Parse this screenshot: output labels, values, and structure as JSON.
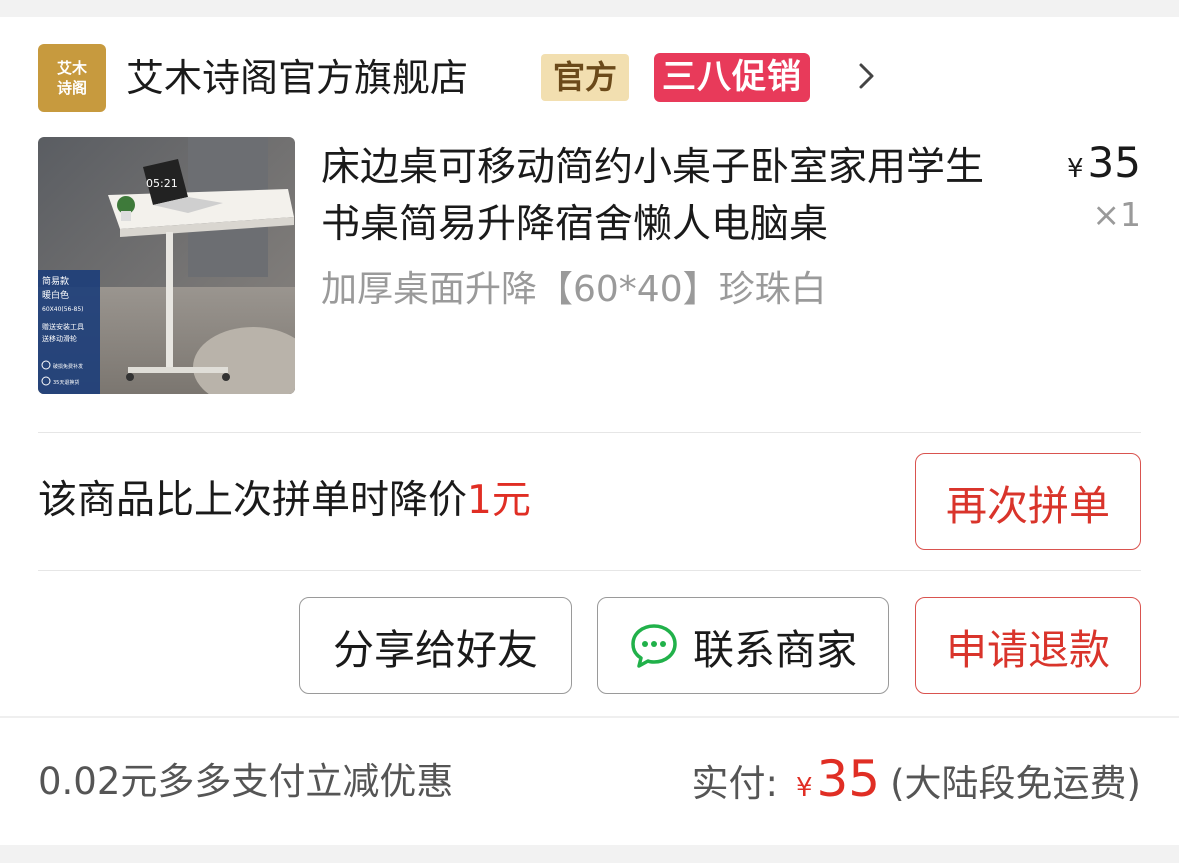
{
  "store": {
    "logo_line1": "艾木",
    "logo_line2": "诗阁",
    "name": "艾木诗阁官方旗舰店",
    "badge_official": "官方",
    "badge_promo": "三八促销",
    "chevron_icon": "chevron-right-icon"
  },
  "product": {
    "title": "床边桌可移动简约小桌子卧室家用学生书桌简易升降宿舍懒人电脑桌",
    "spec": "加厚桌面升降【60*40】珍珠白",
    "currency": "¥",
    "price": "35",
    "quantity": "×1",
    "image": {
      "clock": "05:21",
      "tag_line1": "简易款",
      "tag_line2": "暖白色",
      "tag_line3": "60X40(56-85)",
      "tag_line4": "赠送安装工具",
      "tag_line5": "送移动滑轮",
      "tag_line6": "破损免费补发",
      "tag_line7": "35天退换货"
    }
  },
  "price_notice": {
    "text": "该商品比上次拼单时降价",
    "amount": "1元"
  },
  "buttons": {
    "reorder": "再次拼单",
    "share": "分享给好友",
    "contact": "联系商家",
    "refund": "申请退款"
  },
  "footer": {
    "discount": "0.02元多多支付立减优惠",
    "paid_label": "实付:",
    "currency": "¥",
    "paid_amount": "35",
    "shipping_note": "(大陆段免运费)"
  },
  "colors": {
    "accent_red": "#e02e24",
    "promo_pink": "#e83a5a",
    "official_gold": "#f2dfb0",
    "logo_gold": "#c79a3e",
    "wechat_green": "#21b14a"
  }
}
